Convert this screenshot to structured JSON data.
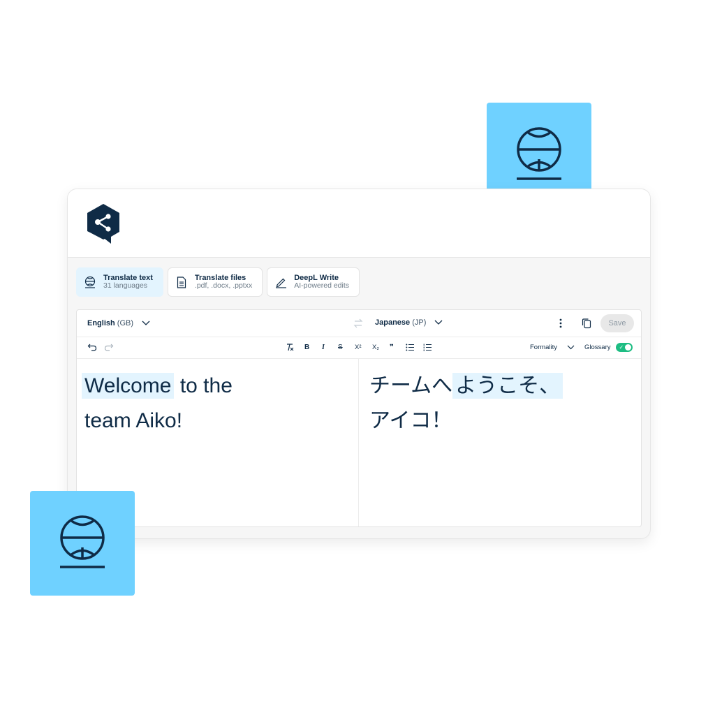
{
  "tabs": [
    {
      "title": "Translate text",
      "subtitle": "31 languages",
      "icon": "globe-icon",
      "active": true
    },
    {
      "title": "Translate files",
      "subtitle": ".pdf, .docx, .pptxx",
      "icon": "document-icon",
      "active": false
    },
    {
      "title": "DeepL Write",
      "subtitle": "AI-powered edits",
      "icon": "pen-icon",
      "active": false
    }
  ],
  "source_lang": {
    "name": "English",
    "code": "(GB)"
  },
  "target_lang": {
    "name": "Japanese",
    "code": "(JP)"
  },
  "toolbar": {
    "save_label": "Save",
    "formality_label": "Formality",
    "glossary_label": "Glossary",
    "glossary_enabled": true,
    "bold": "B",
    "italic": "I",
    "strike": "S",
    "superscript": "X²",
    "subscript": "X₂",
    "quote": "❞"
  },
  "source_text": {
    "line1_highlight": "Welcome",
    "line1_rest": " to the",
    "line2": "team Aiko!"
  },
  "target_text": {
    "line1_plain": "チームへ",
    "line1_highlight": "ようこそ、",
    "line2": "アイコ！"
  },
  "colors": {
    "accent_tile": "#6fd1ff",
    "highlight": "#e3f4fe",
    "navy": "#0f2b46",
    "toggle_on": "#1ebd83"
  }
}
